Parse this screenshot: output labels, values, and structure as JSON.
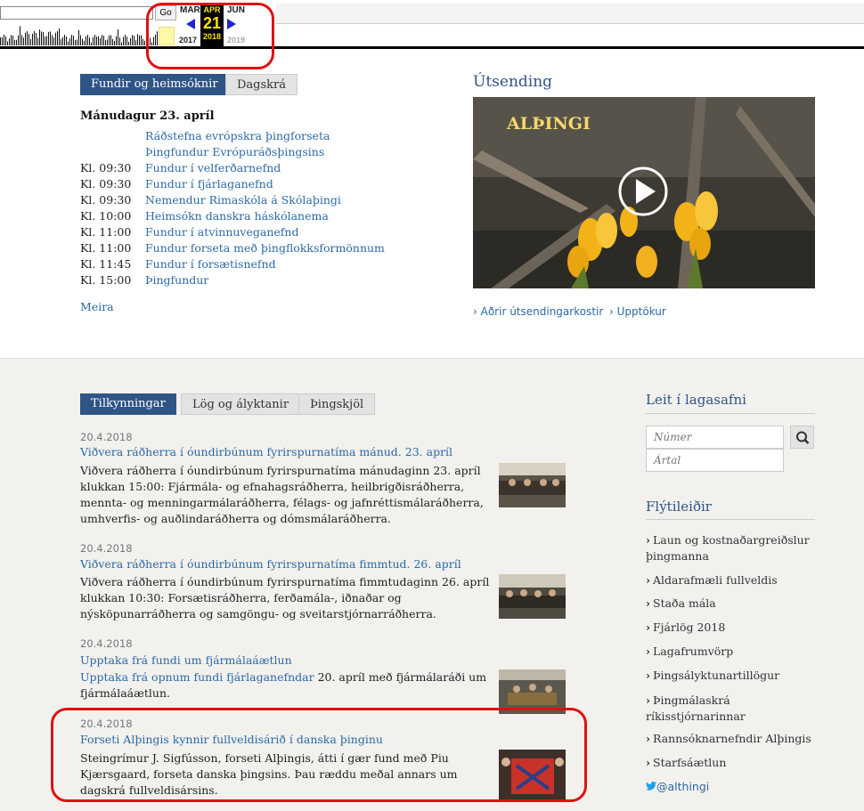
{
  "wayback": {
    "go_label": "Go",
    "months": {
      "prev": "MAR",
      "current": "APR",
      "next": "JUN"
    },
    "day": "21",
    "years": {
      "prev": "2017",
      "current": "2018",
      "next": "2019"
    }
  },
  "meetings": {
    "tabs": [
      "Fundir og heimsóknir",
      "Dagskrá"
    ],
    "day_title": "Mánudagur 23. apríl",
    "events": [
      {
        "time": "",
        "name": "Ráðstefna evrópskra þingforseta"
      },
      {
        "time": "",
        "name": "Þingfundur Evrópuráðsþingsins"
      },
      {
        "time": "Kl. 09:30",
        "name": "Fundur í velferðarnefnd"
      },
      {
        "time": "Kl. 09:30",
        "name": "Fundur í fjárlaganefnd"
      },
      {
        "time": "Kl. 09:30",
        "name": "Nemendur Rimaskóla á Skólaþingi"
      },
      {
        "time": "Kl. 10:00",
        "name": "Heimsókn danskra háskólanema"
      },
      {
        "time": "Kl. 11:00",
        "name": "Fundur í atvinnuveganefnd"
      },
      {
        "time": "Kl. 11:00",
        "name": "Fundur forseta með þingflokksformönnum"
      },
      {
        "time": "Kl. 11:45",
        "name": "Fundur í forsætisnefnd"
      },
      {
        "time": "Kl. 15:00",
        "name": "Þingfundur"
      }
    ],
    "more": "Meira"
  },
  "broadcast": {
    "title": "Útsending",
    "video_overlay": "ALÞINGI",
    "links": [
      "Aðrir útsendingarkostir",
      "Upptökur"
    ]
  },
  "news": {
    "tabs": [
      "Tilkynningar",
      "Lög og ályktanir",
      "Þingskjöl"
    ],
    "items": [
      {
        "date": "20.4.2018",
        "title": "Viðvera ráðherra í óundirbúnum fyrirspurnatíma mánud. 23. apríl",
        "body": "Viðvera ráðherra í óundirbúnum fyrirspurnatíma mánudaginn 23. apríl klukkan 15:00: Fjármála- og efnahagsráðherra, heilbrigðisráðherra, mennta- og menningarmálaráðherra, félags- og jafnréttismálaráðherra, umhverfis- og auðlindaráðherra og dómsmálaráðherra."
      },
      {
        "date": "20.4.2018",
        "title": "Viðvera ráðherra í óundirbúnum fyrirspurnatíma fimmtud. 26. apríl",
        "body": "Viðvera ráðherra í óundirbúnum fyrirspurnatíma fimmtudaginn 26. apríl klukkan 10:30: Forsætisráðherra, ferðamála-, iðnaðar og nýsköpunarráðherra og samgöngu- og sveitarstjórnarráðherra."
      },
      {
        "date": "20.4.2018",
        "title": "Upptaka frá fundi um fjármálaáætlun",
        "body_link": "Upptaka frá opnum fundi fjárlaganefndar",
        "body": " 20. apríl með fjármálaráði um fjármálaáætlun."
      },
      {
        "date": "20.4.2018",
        "title": "Forseti Alþingis kynnir fullveldisárið í danska þinginu",
        "body": "Steingrímur J. Sigfússon, forseti Alþingis, átti í gær fund með Piu Kjærsgaard, forseta danska þingsins. Þau ræddu meðal annars um dagskrá fullveldisársins."
      }
    ]
  },
  "sidebar": {
    "search_title": "Leit í lagasafni",
    "number_placeholder": "Númer",
    "year_placeholder": "Ártal",
    "shortcuts_title": "Flýtileiðir",
    "shortcuts": [
      "Laun og kostnaðargreiðslur þingmanna",
      "Aldarafmæli fullveldis",
      "Staða mála",
      "Fjárlög 2018",
      "Lagafrumvörp",
      "Þingsályktunartillögur",
      "Þingmálaskrá ríkisstjórnarinnar",
      "Rannsóknarnefndir Alþingis",
      "Starfsáætlun"
    ],
    "twitter": "@althingi"
  },
  "colors": {
    "brand": "#2f5486",
    "link": "#2b6aa6",
    "annotation": "#e01010",
    "wayback_highlight": "#ffe400"
  }
}
